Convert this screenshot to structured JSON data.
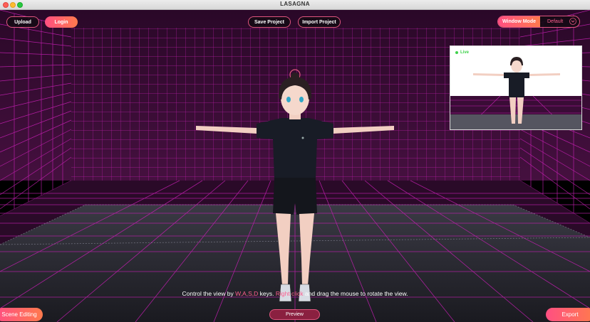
{
  "window": {
    "title": "LASAGNA"
  },
  "toolbar": {
    "upload_label": "Upload",
    "login_label": "Login",
    "save_label": "Save Project",
    "import_label": "Import Project",
    "window_mode_label": "Window Mode",
    "window_mode_value": "Default"
  },
  "live_preview": {
    "label": "Live"
  },
  "hint": {
    "part1": "Control the view by ",
    "keys": "W,A,S,D",
    "part2": " keys. ",
    "mouse": "Right click",
    "part3": " and drag the mouse to rotate the view."
  },
  "bottom": {
    "scene_editing_label": "Scene Editing",
    "preview_label": "Preview",
    "export_label": "Export"
  },
  "colors": {
    "accent": "#ff4f82",
    "accent_end": "#ff7a4d",
    "grid_line": "#c21fb0",
    "wall_bg": "#3a0c36",
    "live": "#3fd14b"
  }
}
